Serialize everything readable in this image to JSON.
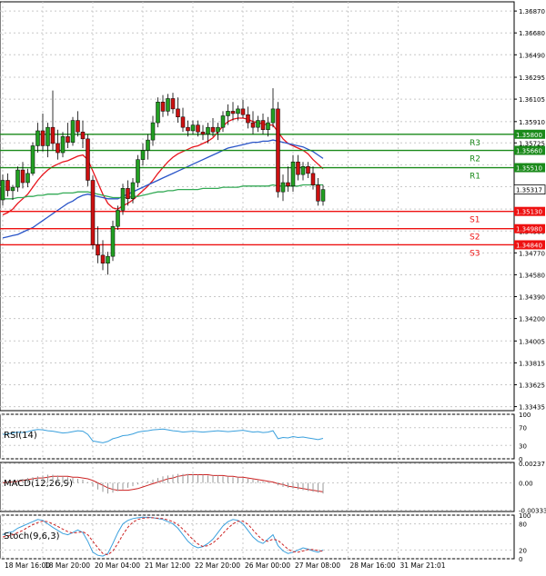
{
  "colors": {
    "background": "#ffffff",
    "grid": "#c8c8c8",
    "axis": "#000000",
    "bull": "#22a022",
    "bear": "#cc1111",
    "resistance": "#1a8a1a",
    "support": "#ee1111",
    "ma_red": "#e8141c",
    "ma_blue": "#2a55c8",
    "ma_green": "#33aa55",
    "rsi": "#3aa0dd",
    "macd_line": "#cc2222",
    "macd_hist": "#999999",
    "stoch_main": "#3aa0dd",
    "stoch_signal": "#cc2222",
    "current_label": "#000000"
  },
  "chart_data": [
    {
      "type": "candlestick",
      "panel": "price",
      "ylim": [
        1.334,
        1.3695
      ],
      "y_ticks": [
        "1.36870",
        "1.36680",
        "1.36490",
        "1.36295",
        "1.36105",
        "1.35910",
        "1.35725",
        "1.35535",
        "1.35345",
        "1.35150",
        "1.34960",
        "1.34770",
        "1.34580",
        "1.34390",
        "1.34200",
        "1.34005",
        "1.33815",
        "1.33625",
        "1.33435"
      ],
      "x_ticks": [
        "18 Mar 16:00",
        "18 Mar 20:00",
        "20 Mar 04:00",
        "21 Mar 12:00",
        "22 Mar 20:00",
        "26 Mar 00:00",
        "27 Mar 08:00",
        "28 Mar 16:00",
        "31 Mar 21:01"
      ],
      "x_tick_positions": [
        0,
        8,
        18,
        28,
        38,
        48,
        58,
        69,
        79
      ],
      "candles": [
        {
          "o": 1.3523,
          "h": 1.3545,
          "l": 1.3518,
          "c": 1.354
        },
        {
          "o": 1.354,
          "h": 1.3546,
          "l": 1.3526,
          "c": 1.3531
        },
        {
          "o": 1.3531,
          "h": 1.3536,
          "l": 1.3523,
          "c": 1.3534
        },
        {
          "o": 1.3534,
          "h": 1.3552,
          "l": 1.353,
          "c": 1.3549
        },
        {
          "o": 1.3549,
          "h": 1.3556,
          "l": 1.3533,
          "c": 1.3538
        },
        {
          "o": 1.3538,
          "h": 1.355,
          "l": 1.3534,
          "c": 1.3546
        },
        {
          "o": 1.3546,
          "h": 1.3573,
          "l": 1.3544,
          "c": 1.357
        },
        {
          "o": 1.357,
          "h": 1.359,
          "l": 1.3564,
          "c": 1.3583
        },
        {
          "o": 1.3583,
          "h": 1.3598,
          "l": 1.3565,
          "c": 1.357
        },
        {
          "o": 1.357,
          "h": 1.359,
          "l": 1.356,
          "c": 1.3586
        },
        {
          "o": 1.3586,
          "h": 1.3618,
          "l": 1.3566,
          "c": 1.3572
        },
        {
          "o": 1.3572,
          "h": 1.3584,
          "l": 1.3558,
          "c": 1.3564
        },
        {
          "o": 1.3564,
          "h": 1.3582,
          "l": 1.356,
          "c": 1.3578
        },
        {
          "o": 1.3578,
          "h": 1.359,
          "l": 1.3568,
          "c": 1.3573
        },
        {
          "o": 1.3573,
          "h": 1.3595,
          "l": 1.357,
          "c": 1.3592
        },
        {
          "o": 1.3592,
          "h": 1.36,
          "l": 1.3578,
          "c": 1.3582
        },
        {
          "o": 1.3582,
          "h": 1.3592,
          "l": 1.3568,
          "c": 1.3576
        },
        {
          "o": 1.3576,
          "h": 1.358,
          "l": 1.3535,
          "c": 1.354
        },
        {
          "o": 1.354,
          "h": 1.3544,
          "l": 1.348,
          "c": 1.3484
        },
        {
          "o": 1.3484,
          "h": 1.35,
          "l": 1.3468,
          "c": 1.3475
        },
        {
          "o": 1.3475,
          "h": 1.3488,
          "l": 1.3462,
          "c": 1.3468
        },
        {
          "o": 1.3468,
          "h": 1.3478,
          "l": 1.3458,
          "c": 1.3474
        },
        {
          "o": 1.3474,
          "h": 1.3505,
          "l": 1.347,
          "c": 1.35
        },
        {
          "o": 1.35,
          "h": 1.3518,
          "l": 1.3497,
          "c": 1.3514
        },
        {
          "o": 1.3514,
          "h": 1.3537,
          "l": 1.351,
          "c": 1.3533
        },
        {
          "o": 1.3533,
          "h": 1.354,
          "l": 1.3518,
          "c": 1.3524
        },
        {
          "o": 1.3524,
          "h": 1.3542,
          "l": 1.352,
          "c": 1.3538
        },
        {
          "o": 1.3538,
          "h": 1.3562,
          "l": 1.3534,
          "c": 1.3558
        },
        {
          "o": 1.3558,
          "h": 1.3572,
          "l": 1.3553,
          "c": 1.3566
        },
        {
          "o": 1.3566,
          "h": 1.358,
          "l": 1.3558,
          "c": 1.3575
        },
        {
          "o": 1.3575,
          "h": 1.3596,
          "l": 1.357,
          "c": 1.359
        },
        {
          "o": 1.359,
          "h": 1.3612,
          "l": 1.3586,
          "c": 1.3608
        },
        {
          "o": 1.3608,
          "h": 1.3614,
          "l": 1.3595,
          "c": 1.36
        },
        {
          "o": 1.36,
          "h": 1.3615,
          "l": 1.3596,
          "c": 1.3611
        },
        {
          "o": 1.3611,
          "h": 1.3616,
          "l": 1.3598,
          "c": 1.3602
        },
        {
          "o": 1.3602,
          "h": 1.3612,
          "l": 1.359,
          "c": 1.3595
        },
        {
          "o": 1.3595,
          "h": 1.3603,
          "l": 1.3582,
          "c": 1.3586
        },
        {
          "o": 1.3586,
          "h": 1.3592,
          "l": 1.3578,
          "c": 1.3583
        },
        {
          "o": 1.3583,
          "h": 1.3592,
          "l": 1.358,
          "c": 1.3588
        },
        {
          "o": 1.3588,
          "h": 1.3592,
          "l": 1.3578,
          "c": 1.3582
        },
        {
          "o": 1.3582,
          "h": 1.3588,
          "l": 1.3575,
          "c": 1.358
        },
        {
          "o": 1.358,
          "h": 1.359,
          "l": 1.3572,
          "c": 1.3586
        },
        {
          "o": 1.3586,
          "h": 1.3594,
          "l": 1.3578,
          "c": 1.3582
        },
        {
          "o": 1.3582,
          "h": 1.359,
          "l": 1.3575,
          "c": 1.3586
        },
        {
          "o": 1.3586,
          "h": 1.36,
          "l": 1.3582,
          "c": 1.3596
        },
        {
          "o": 1.3596,
          "h": 1.3606,
          "l": 1.3588,
          "c": 1.36
        },
        {
          "o": 1.36,
          "h": 1.3608,
          "l": 1.3592,
          "c": 1.3598
        },
        {
          "o": 1.3598,
          "h": 1.3605,
          "l": 1.3592,
          "c": 1.3602
        },
        {
          "o": 1.3602,
          "h": 1.361,
          "l": 1.3594,
          "c": 1.3597
        },
        {
          "o": 1.3597,
          "h": 1.3604,
          "l": 1.3585,
          "c": 1.359
        },
        {
          "o": 1.359,
          "h": 1.36,
          "l": 1.358,
          "c": 1.3586
        },
        {
          "o": 1.3586,
          "h": 1.3596,
          "l": 1.3582,
          "c": 1.3592
        },
        {
          "o": 1.3592,
          "h": 1.3598,
          "l": 1.358,
          "c": 1.3584
        },
        {
          "o": 1.3584,
          "h": 1.3595,
          "l": 1.3578,
          "c": 1.359
        },
        {
          "o": 1.359,
          "h": 1.362,
          "l": 1.3586,
          "c": 1.3602
        },
        {
          "o": 1.3602,
          "h": 1.3608,
          "l": 1.3525,
          "c": 1.353
        },
        {
          "o": 1.353,
          "h": 1.3545,
          "l": 1.3522,
          "c": 1.3538
        },
        {
          "o": 1.3538,
          "h": 1.3552,
          "l": 1.353,
          "c": 1.3535
        },
        {
          "o": 1.3535,
          "h": 1.3562,
          "l": 1.353,
          "c": 1.3556
        },
        {
          "o": 1.3556,
          "h": 1.3562,
          "l": 1.354,
          "c": 1.3545
        },
        {
          "o": 1.3545,
          "h": 1.3556,
          "l": 1.354,
          "c": 1.3552
        },
        {
          "o": 1.3552,
          "h": 1.3556,
          "l": 1.3542,
          "c": 1.3546
        },
        {
          "o": 1.3546,
          "h": 1.3552,
          "l": 1.3532,
          "c": 1.3536
        },
        {
          "o": 1.3536,
          "h": 1.3542,
          "l": 1.3518,
          "c": 1.3522
        },
        {
          "o": 1.3522,
          "h": 1.3536,
          "l": 1.3518,
          "c": 1.3532
        }
      ],
      "current_price": "1.35317",
      "levels": [
        {
          "name": "R3",
          "value": 1.358,
          "label": "1.35800",
          "kind": "resistance"
        },
        {
          "name": "R2",
          "value": 1.3566,
          "label": "1.35660",
          "kind": "resistance"
        },
        {
          "name": "R1",
          "value": 1.3551,
          "label": "1.35510",
          "kind": "resistance"
        },
        {
          "name": "S1",
          "value": 1.3513,
          "label": "1.35130",
          "kind": "support"
        },
        {
          "name": "S2",
          "value": 1.3498,
          "label": "1.34980",
          "kind": "support"
        },
        {
          "name": "S3",
          "value": 1.3484,
          "label": "1.34840",
          "kind": "support"
        }
      ],
      "moving_averages": [
        {
          "color_key": "ma_red",
          "values": [
            1.351,
            1.3512,
            1.3515,
            1.352,
            1.3524,
            1.3528,
            1.3534,
            1.354,
            1.3545,
            1.3549,
            1.3552,
            1.3554,
            1.3556,
            1.3557,
            1.3559,
            1.3561,
            1.3562,
            1.3558,
            1.3548,
            1.3538,
            1.3528,
            1.352,
            1.3516,
            1.3515,
            1.3518,
            1.352,
            1.3523,
            1.3527,
            1.3531,
            1.3535,
            1.354,
            1.3546,
            1.3551,
            1.3556,
            1.356,
            1.3563,
            1.3565,
            1.3567,
            1.3569,
            1.357,
            1.3572,
            1.3574,
            1.3577,
            1.3582,
            1.3587,
            1.3591,
            1.3593,
            1.3594,
            1.3594,
            1.3593,
            1.3591,
            1.359,
            1.3589,
            1.3588,
            1.3588,
            1.3582,
            1.3576,
            1.3572,
            1.357,
            1.3568,
            1.3566,
            1.3563,
            1.3558,
            1.3554,
            1.355
          ]
        },
        {
          "color_key": "ma_blue",
          "values": [
            1.349,
            1.3491,
            1.3492,
            1.3493,
            1.3495,
            1.3497,
            1.3499,
            1.3502,
            1.3505,
            1.3508,
            1.3511,
            1.3514,
            1.3517,
            1.352,
            1.3522,
            1.3525,
            1.3527,
            1.3528,
            1.3527,
            1.3526,
            1.3525,
            1.3524,
            1.3524,
            1.3524,
            1.3526,
            1.3528,
            1.353,
            1.3532,
            1.3534,
            1.3536,
            1.3538,
            1.354,
            1.3542,
            1.3544,
            1.3546,
            1.3548,
            1.355,
            1.3552,
            1.3554,
            1.3556,
            1.3558,
            1.356,
            1.3562,
            1.3564,
            1.3566,
            1.3568,
            1.3569,
            1.357,
            1.3571,
            1.3572,
            1.3573,
            1.3573,
            1.3574,
            1.3574,
            1.3575,
            1.3574,
            1.3573,
            1.3572,
            1.3571,
            1.357,
            1.3569,
            1.3567,
            1.3565,
            1.3562,
            1.3559
          ]
        },
        {
          "color_key": "ma_green",
          "values": [
            1.3524,
            1.3524,
            1.3524,
            1.3525,
            1.3525,
            1.3526,
            1.3526,
            1.3527,
            1.3527,
            1.3528,
            1.3528,
            1.3528,
            1.3529,
            1.3529,
            1.3529,
            1.353,
            1.353,
            1.353,
            1.3529,
            1.3528,
            1.3527,
            1.3526,
            1.3525,
            1.3525,
            1.3525,
            1.3525,
            1.3526,
            1.3526,
            1.3527,
            1.3528,
            1.3529,
            1.353,
            1.353,
            1.3531,
            1.3531,
            1.3532,
            1.3532,
            1.3532,
            1.3532,
            1.3532,
            1.3533,
            1.3533,
            1.3533,
            1.3533,
            1.3534,
            1.3534,
            1.3534,
            1.3534,
            1.3535,
            1.3535,
            1.3535,
            1.3535,
            1.3535,
            1.3535,
            1.3536,
            1.3535,
            1.3535,
            1.3535,
            1.3535,
            1.3535,
            1.3536,
            1.3536,
            1.3536,
            1.3536,
            1.3536
          ]
        }
      ]
    },
    {
      "type": "line",
      "panel": "rsi",
      "label": "RSI(14)",
      "ylim": [
        0,
        100
      ],
      "y_ticks": [
        "100",
        "70",
        "30",
        "0"
      ],
      "y_tick_values": [
        100,
        70,
        30,
        0
      ],
      "values": [
        55,
        56,
        58,
        60,
        59,
        61,
        64,
        66,
        65,
        63,
        62,
        60,
        58,
        59,
        61,
        63,
        62,
        55,
        40,
        38,
        36,
        39,
        45,
        48,
        52,
        53,
        56,
        60,
        62,
        63,
        65,
        66,
        67,
        65,
        63,
        62,
        60,
        61,
        62,
        61,
        60,
        61,
        62,
        63,
        62,
        61,
        62,
        63,
        64,
        62,
        60,
        61,
        59,
        60,
        63,
        45,
        48,
        47,
        50,
        48,
        49,
        47,
        45,
        43,
        46
      ]
    },
    {
      "type": "line",
      "panel": "macd",
      "label": "MACD(12,26,9)",
      "ylim": [
        -0.0035,
        0.0025
      ],
      "y_ticks": [
        "0.00237",
        "0.00",
        "-0.003331"
      ],
      "y_tick_values": [
        0.00237,
        0.0,
        -0.00333
      ],
      "histogram": [
        0.0001,
        0.0002,
        0.0003,
        0.0004,
        0.0005,
        0.0006,
        0.0007,
        0.0008,
        0.0009,
        0.001,
        0.001,
        0.0009,
        0.0008,
        0.0007,
        0.0006,
        0.0005,
        0.0004,
        0.0001,
        -0.0004,
        -0.0008,
        -0.0011,
        -0.0013,
        -0.0012,
        -0.001,
        -0.0008,
        -0.0006,
        -0.0004,
        -0.0002,
        0.0,
        0.0002,
        0.0004,
        0.0006,
        0.0008,
        0.0009,
        0.001,
        0.0011,
        0.0011,
        0.0011,
        0.0011,
        0.001,
        0.001,
        0.0009,
        0.0009,
        0.0009,
        0.0008,
        0.0008,
        0.0007,
        0.0007,
        0.0006,
        0.0005,
        0.0004,
        0.0003,
        0.0002,
        0.0001,
        0.0,
        -0.0003,
        -0.0005,
        -0.0006,
        -0.0007,
        -0.0008,
        -0.0009,
        -0.001,
        -0.0011,
        -0.0012,
        -0.0013
      ],
      "signal": [
        0.0,
        0.0001,
        0.0001,
        0.0002,
        0.0003,
        0.0004,
        0.0005,
        0.0006,
        0.0006,
        0.0007,
        0.0008,
        0.0008,
        0.0008,
        0.0008,
        0.0007,
        0.0007,
        0.0006,
        0.0005,
        0.0003,
        0.0,
        -0.0003,
        -0.0006,
        -0.0008,
        -0.0009,
        -0.0009,
        -0.0009,
        -0.0008,
        -0.0007,
        -0.0005,
        -0.0003,
        -0.0001,
        0.0001,
        0.0003,
        0.0005,
        0.0006,
        0.0008,
        0.0009,
        0.001,
        0.001,
        0.001,
        0.001,
        0.001,
        0.0009,
        0.0009,
        0.0009,
        0.0008,
        0.0008,
        0.0007,
        0.0007,
        0.0006,
        0.0005,
        0.0004,
        0.0003,
        0.0002,
        0.0001,
        -0.0001,
        -0.0002,
        -0.0004,
        -0.0005,
        -0.0006,
        -0.0007,
        -0.0008,
        -0.0009,
        -0.001,
        -0.0011
      ]
    },
    {
      "type": "line",
      "panel": "stoch",
      "label": "Stoch(9,6,3)",
      "ylim": [
        0,
        100
      ],
      "y_ticks": [
        "100",
        "80",
        "20",
        "0"
      ],
      "y_tick_values": [
        100,
        80,
        20,
        0
      ],
      "main": [
        55,
        60,
        62,
        70,
        75,
        80,
        85,
        90,
        88,
        80,
        72,
        65,
        58,
        55,
        60,
        66,
        60,
        40,
        15,
        8,
        6,
        12,
        35,
        60,
        80,
        88,
        92,
        94,
        95,
        95,
        94,
        92,
        90,
        85,
        80,
        70,
        55,
        40,
        30,
        25,
        28,
        35,
        45,
        60,
        75,
        85,
        90,
        88,
        80,
        65,
        50,
        40,
        35,
        45,
        55,
        30,
        18,
        12,
        15,
        20,
        25,
        22,
        18,
        15,
        20
      ],
      "signal": [
        50,
        52,
        55,
        60,
        65,
        72,
        78,
        83,
        86,
        85,
        80,
        74,
        68,
        62,
        59,
        60,
        62,
        55,
        40,
        25,
        12,
        9,
        18,
        35,
        55,
        72,
        84,
        90,
        93,
        94,
        94,
        93,
        92,
        89,
        85,
        78,
        68,
        56,
        44,
        34,
        28,
        30,
        36,
        46,
        58,
        70,
        80,
        86,
        86,
        79,
        66,
        53,
        43,
        40,
        45,
        42,
        32,
        22,
        16,
        15,
        18,
        21,
        21,
        19,
        17
      ]
    }
  ]
}
